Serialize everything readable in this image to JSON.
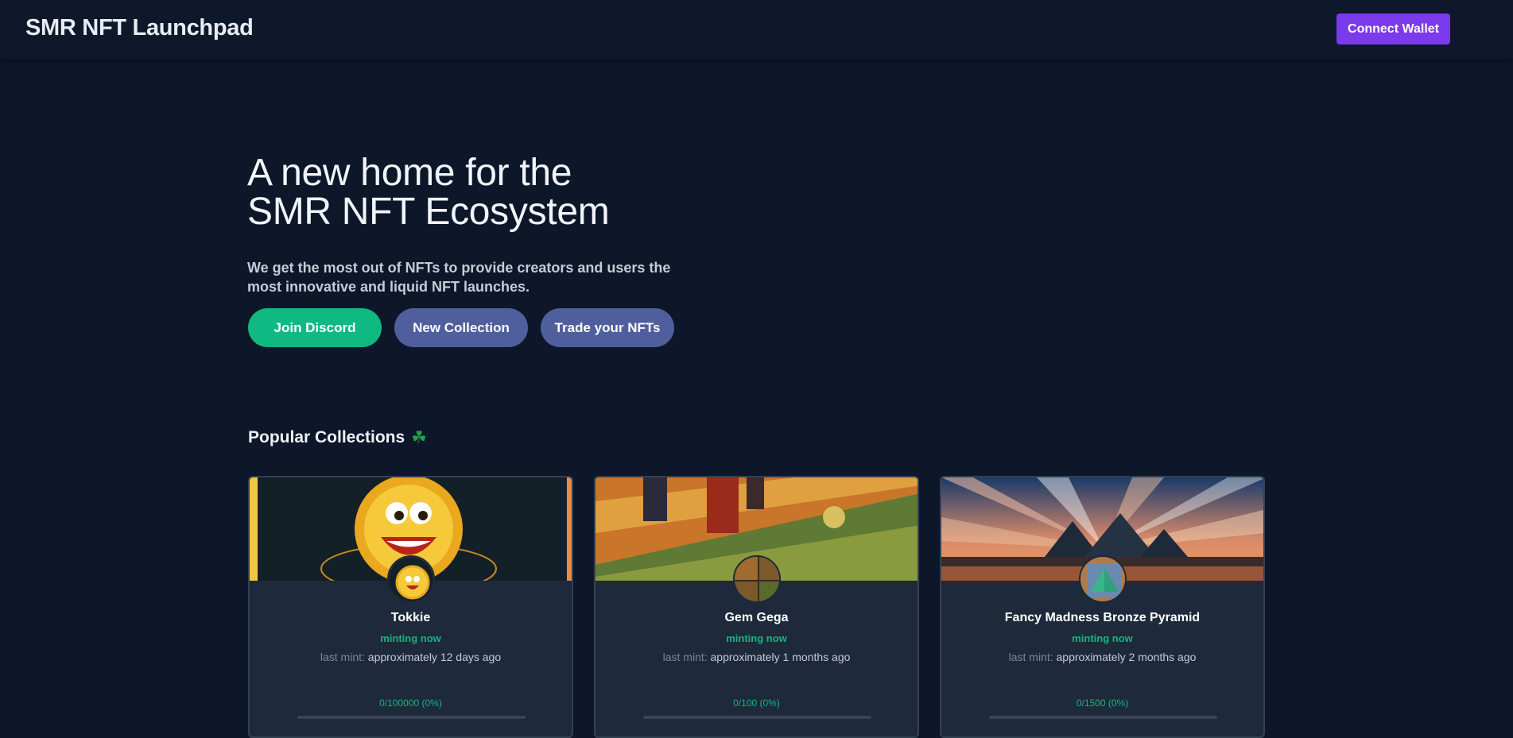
{
  "header": {
    "brand": "SMR NFT Launchpad",
    "connect_label": "Connect Wallet"
  },
  "hero": {
    "title_line1": "A new home for the",
    "title_line2": "SMR NFT Ecosystem",
    "subtitle": "We get the most out of NFTs to provide creators and users the most innovative and liquid NFT launches.",
    "buttons": {
      "discord": "Join Discord",
      "new_collection": "New Collection",
      "trade": "Trade your NFTs"
    }
  },
  "popular": {
    "title": "Popular Collections",
    "icon": "four-leaf-clover-icon"
  },
  "cards": [
    {
      "name": "Tokkie",
      "status": "minting now",
      "last_label": "last mint:",
      "last_value": "approximately 12 days ago",
      "progress_text": "0/100000 (0%)",
      "progress": 0
    },
    {
      "name": "Gem Gega",
      "status": "minting now",
      "last_label": "last mint:",
      "last_value": "approximately 1 months ago",
      "progress_text": "0/100 (0%)",
      "progress": 0
    },
    {
      "name": "Fancy Madness Bronze Pyramid",
      "status": "minting now",
      "last_label": "last mint:",
      "last_value": "approximately 2 months ago",
      "progress_text": "0/1500 (0%)",
      "progress": 0
    }
  ],
  "colors": {
    "background": "#0e1629",
    "accent_purple": "#7c3aed",
    "accent_green": "#10b981",
    "pill_blue": "#4f5f9e",
    "card": "#1e293b"
  }
}
